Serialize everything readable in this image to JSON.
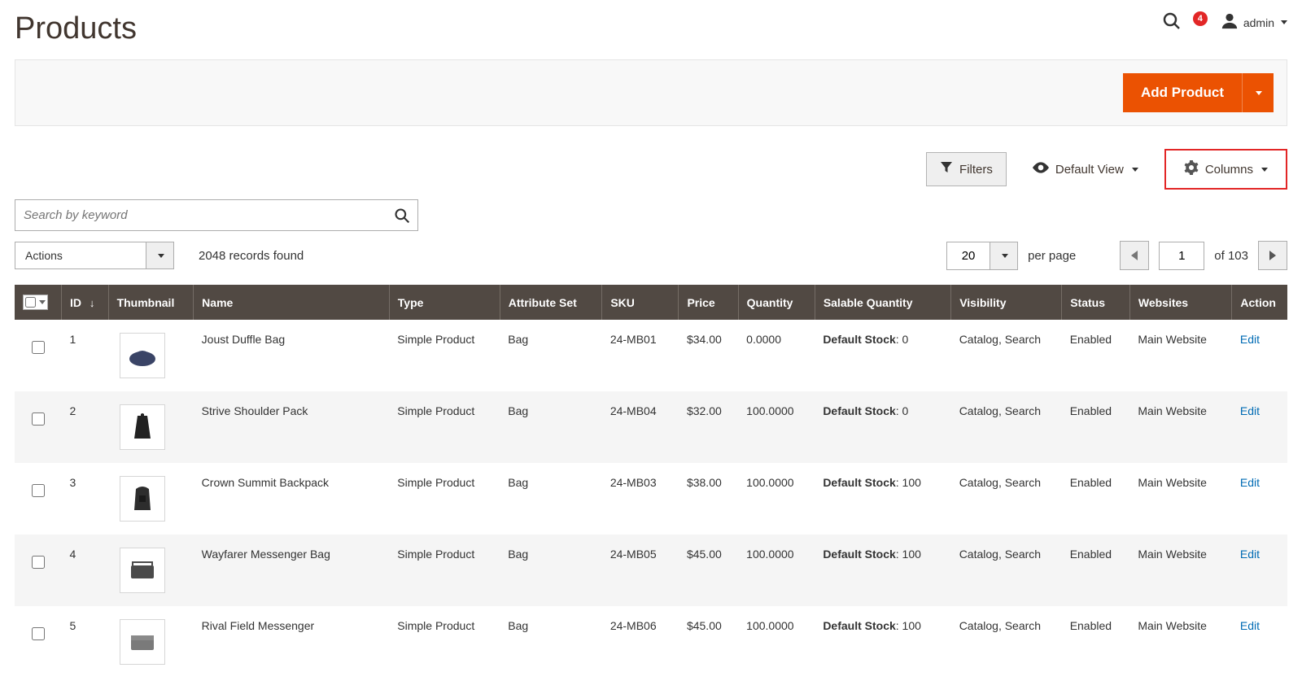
{
  "header": {
    "title": "Products",
    "notification_count": "4",
    "user_name": "admin"
  },
  "actionbar": {
    "add_product": "Add Product"
  },
  "toolbar": {
    "filters_label": "Filters",
    "default_view_label": "Default View",
    "columns_label": "Columns",
    "search_placeholder": "Search by keyword",
    "actions_label": "Actions",
    "records_found": "2048 records found",
    "per_page_value": "20",
    "per_page_label": "per page",
    "page_value": "1",
    "of_pages": "of 103"
  },
  "table": {
    "columns": {
      "id": "ID",
      "thumbnail": "Thumbnail",
      "name": "Name",
      "type": "Type",
      "attribute_set": "Attribute Set",
      "sku": "SKU",
      "price": "Price",
      "quantity": "Quantity",
      "salable_quantity": "Salable Quantity",
      "visibility": "Visibility",
      "status": "Status",
      "websites": "Websites",
      "action": "Action"
    },
    "rows": [
      {
        "id": "1",
        "name": "Joust Duffle Bag",
        "type": "Simple Product",
        "attribute_set": "Bag",
        "sku": "24-MB01",
        "price": "$34.00",
        "quantity": "0.0000",
        "salable_label": "Default Stock",
        "salable_value": ": 0",
        "visibility": "Catalog, Search",
        "status": "Enabled",
        "websites": "Main Website",
        "action": "Edit",
        "thumb": "duffle"
      },
      {
        "id": "2",
        "name": "Strive Shoulder Pack",
        "type": "Simple Product",
        "attribute_set": "Bag",
        "sku": "24-MB04",
        "price": "$32.00",
        "quantity": "100.0000",
        "salable_label": "Default Stock",
        "salable_value": ": 0",
        "visibility": "Catalog, Search",
        "status": "Enabled",
        "websites": "Main Website",
        "action": "Edit",
        "thumb": "shoulder"
      },
      {
        "id": "3",
        "name": "Crown Summit Backpack",
        "type": "Simple Product",
        "attribute_set": "Bag",
        "sku": "24-MB03",
        "price": "$38.00",
        "quantity": "100.0000",
        "salable_label": "Default Stock",
        "salable_value": ": 100",
        "visibility": "Catalog, Search",
        "status": "Enabled",
        "websites": "Main Website",
        "action": "Edit",
        "thumb": "backpack"
      },
      {
        "id": "4",
        "name": "Wayfarer Messenger Bag",
        "type": "Simple Product",
        "attribute_set": "Bag",
        "sku": "24-MB05",
        "price": "$45.00",
        "quantity": "100.0000",
        "salable_label": "Default Stock",
        "salable_value": ": 100",
        "visibility": "Catalog, Search",
        "status": "Enabled",
        "websites": "Main Website",
        "action": "Edit",
        "thumb": "messenger"
      },
      {
        "id": "5",
        "name": "Rival Field Messenger",
        "type": "Simple Product",
        "attribute_set": "Bag",
        "sku": "24-MB06",
        "price": "$45.00",
        "quantity": "100.0000",
        "salable_label": "Default Stock",
        "salable_value": ": 100",
        "visibility": "Catalog, Search",
        "status": "Enabled",
        "websites": "Main Website",
        "action": "Edit",
        "thumb": "field"
      }
    ]
  }
}
